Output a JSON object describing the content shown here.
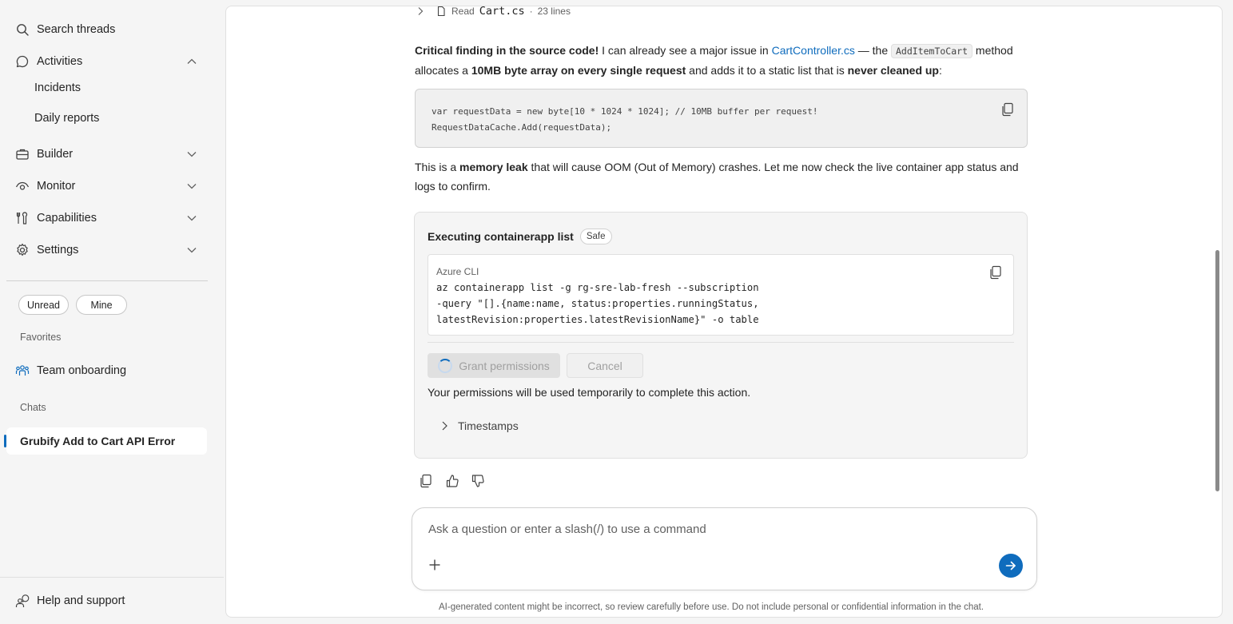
{
  "sidebar": {
    "search_label": "Search threads",
    "activities": {
      "label": "Activities",
      "items": [
        "Incidents",
        "Daily reports"
      ]
    },
    "builder_label": "Builder",
    "monitor_label": "Monitor",
    "capabilities_label": "Capabilities",
    "settings_label": "Settings",
    "filters": [
      "Unread",
      "Mine"
    ],
    "favorites_label": "Favorites",
    "favorite_item": "Team onboarding",
    "chats_label": "Chats",
    "active_chat": "Grubify Add to Cart API Error",
    "help_label": "Help and support"
  },
  "thread": {
    "read": {
      "verb": "Read",
      "file": "Cart.cs",
      "lines": "23 lines"
    },
    "finding": {
      "lead": "Critical finding in the source code!",
      "t1": " I can already see a major issue in ",
      "link": "CartController.cs",
      "t2": " — the ",
      "method": "AddItemToCart",
      "t3": " method allocates a ",
      "b1": "10MB byte array on every single request",
      "t4": " and adds it to a static list that is ",
      "b2": "never cleaned up",
      "t5": ":"
    },
    "code_lines": [
      "var requestData = new byte[10 * 1024 * 1024]; // 10MB buffer per request!",
      "RequestDataCache.Add(requestData);"
    ],
    "leak": {
      "t1": "This is a ",
      "b1": "memory leak",
      "t2": " that will cause OOM (Out of Memory) crashes. Let me now check the live container app status and logs to confirm."
    },
    "exec": {
      "title": "Executing containerapp list",
      "badge": "Safe",
      "cli_label": "Azure CLI",
      "cli_lines": [
        "az containerapp list -g rg-sre-lab-fresh --subscription",
        "-query \"[].{name:name, status:properties.runningStatus,",
        "latestRevision:properties.latestRevisionName}\" -o table"
      ],
      "grant_label": "Grant permissions",
      "cancel_label": "Cancel",
      "permission_note": "Your permissions will be used temporarily to complete this action.",
      "timestamps_label": "Timestamps"
    }
  },
  "composer": {
    "placeholder": "Ask a question or enter a slash(/) to use a command",
    "disclaimer": "AI-generated content might be incorrect, so review carefully before use. Do not include personal or confidential information in the chat."
  },
  "colors": {
    "accent": "#0f6cbd",
    "sidebar_bg": "#f5f5f5",
    "card_bg": "#f5f5f5"
  }
}
